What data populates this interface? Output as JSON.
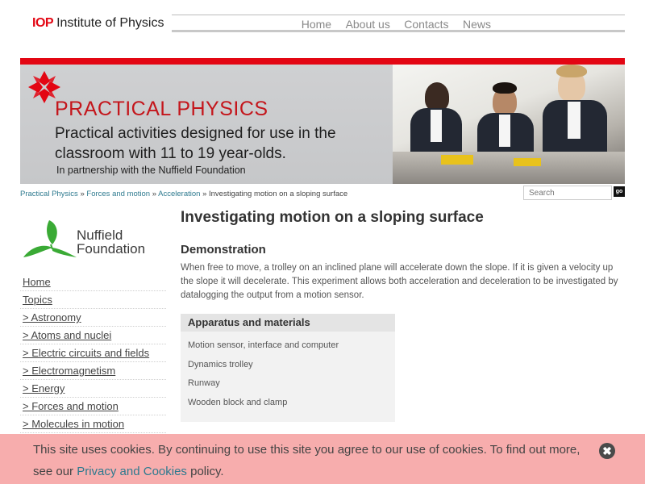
{
  "header": {
    "logo_abbr": "IOP",
    "logo_name": "Institute of Physics",
    "nav": [
      "Home",
      "About us",
      "Contacts",
      "News"
    ]
  },
  "banner": {
    "title": "PRACTICAL PHYSICS",
    "tagline": "Practical activities designed for use in the classroom with 11  to 19 year-olds.",
    "partner": "In partnership with the Nuffield Foundation"
  },
  "breadcrumb": {
    "items": [
      "Practical Physics",
      "Forces and motion",
      "Acceleration"
    ],
    "separator": "»",
    "current": "Investigating motion on a sloping surface"
  },
  "search": {
    "placeholder": "Search",
    "button": "go"
  },
  "sidebar": {
    "logo_line1": "Nuffield",
    "logo_line2": "Foundation",
    "items": [
      "Home",
      "Topics",
      "> Astronomy",
      "> Atoms and nuclei",
      "> Electric circuits and fields",
      "> Electromagnetism",
      "> Energy",
      "> Forces and motion",
      "> Molecules in motion"
    ]
  },
  "main": {
    "title": "Investigating motion on a sloping surface",
    "section": "Demonstration",
    "description": "When free to move, a trolley on an inclined plane will accelerate down the slope. If it is given a velocity up the slope it will decelerate. This experiment allows both acceleration and deceleration to be investigated by datalogging the output from a motion sensor.",
    "apparatus_title": "Apparatus and materials",
    "apparatus": [
      "Motion sensor, interface and computer",
      "Dynamics trolley",
      "Runway",
      "Wooden block and clamp"
    ]
  },
  "cookie": {
    "text_before": "This site uses cookies. By continuing to use this site you agree to our use of cookies. To find out more, see our ",
    "link": "Privacy and Cookies",
    "text_after": " policy.",
    "close": "✖"
  },
  "colors": {
    "brand_red": "#e30613",
    "link_teal": "#2e7a8f",
    "cookie_bg": "#f7adad",
    "nuffield_green": "#3aaa35"
  }
}
